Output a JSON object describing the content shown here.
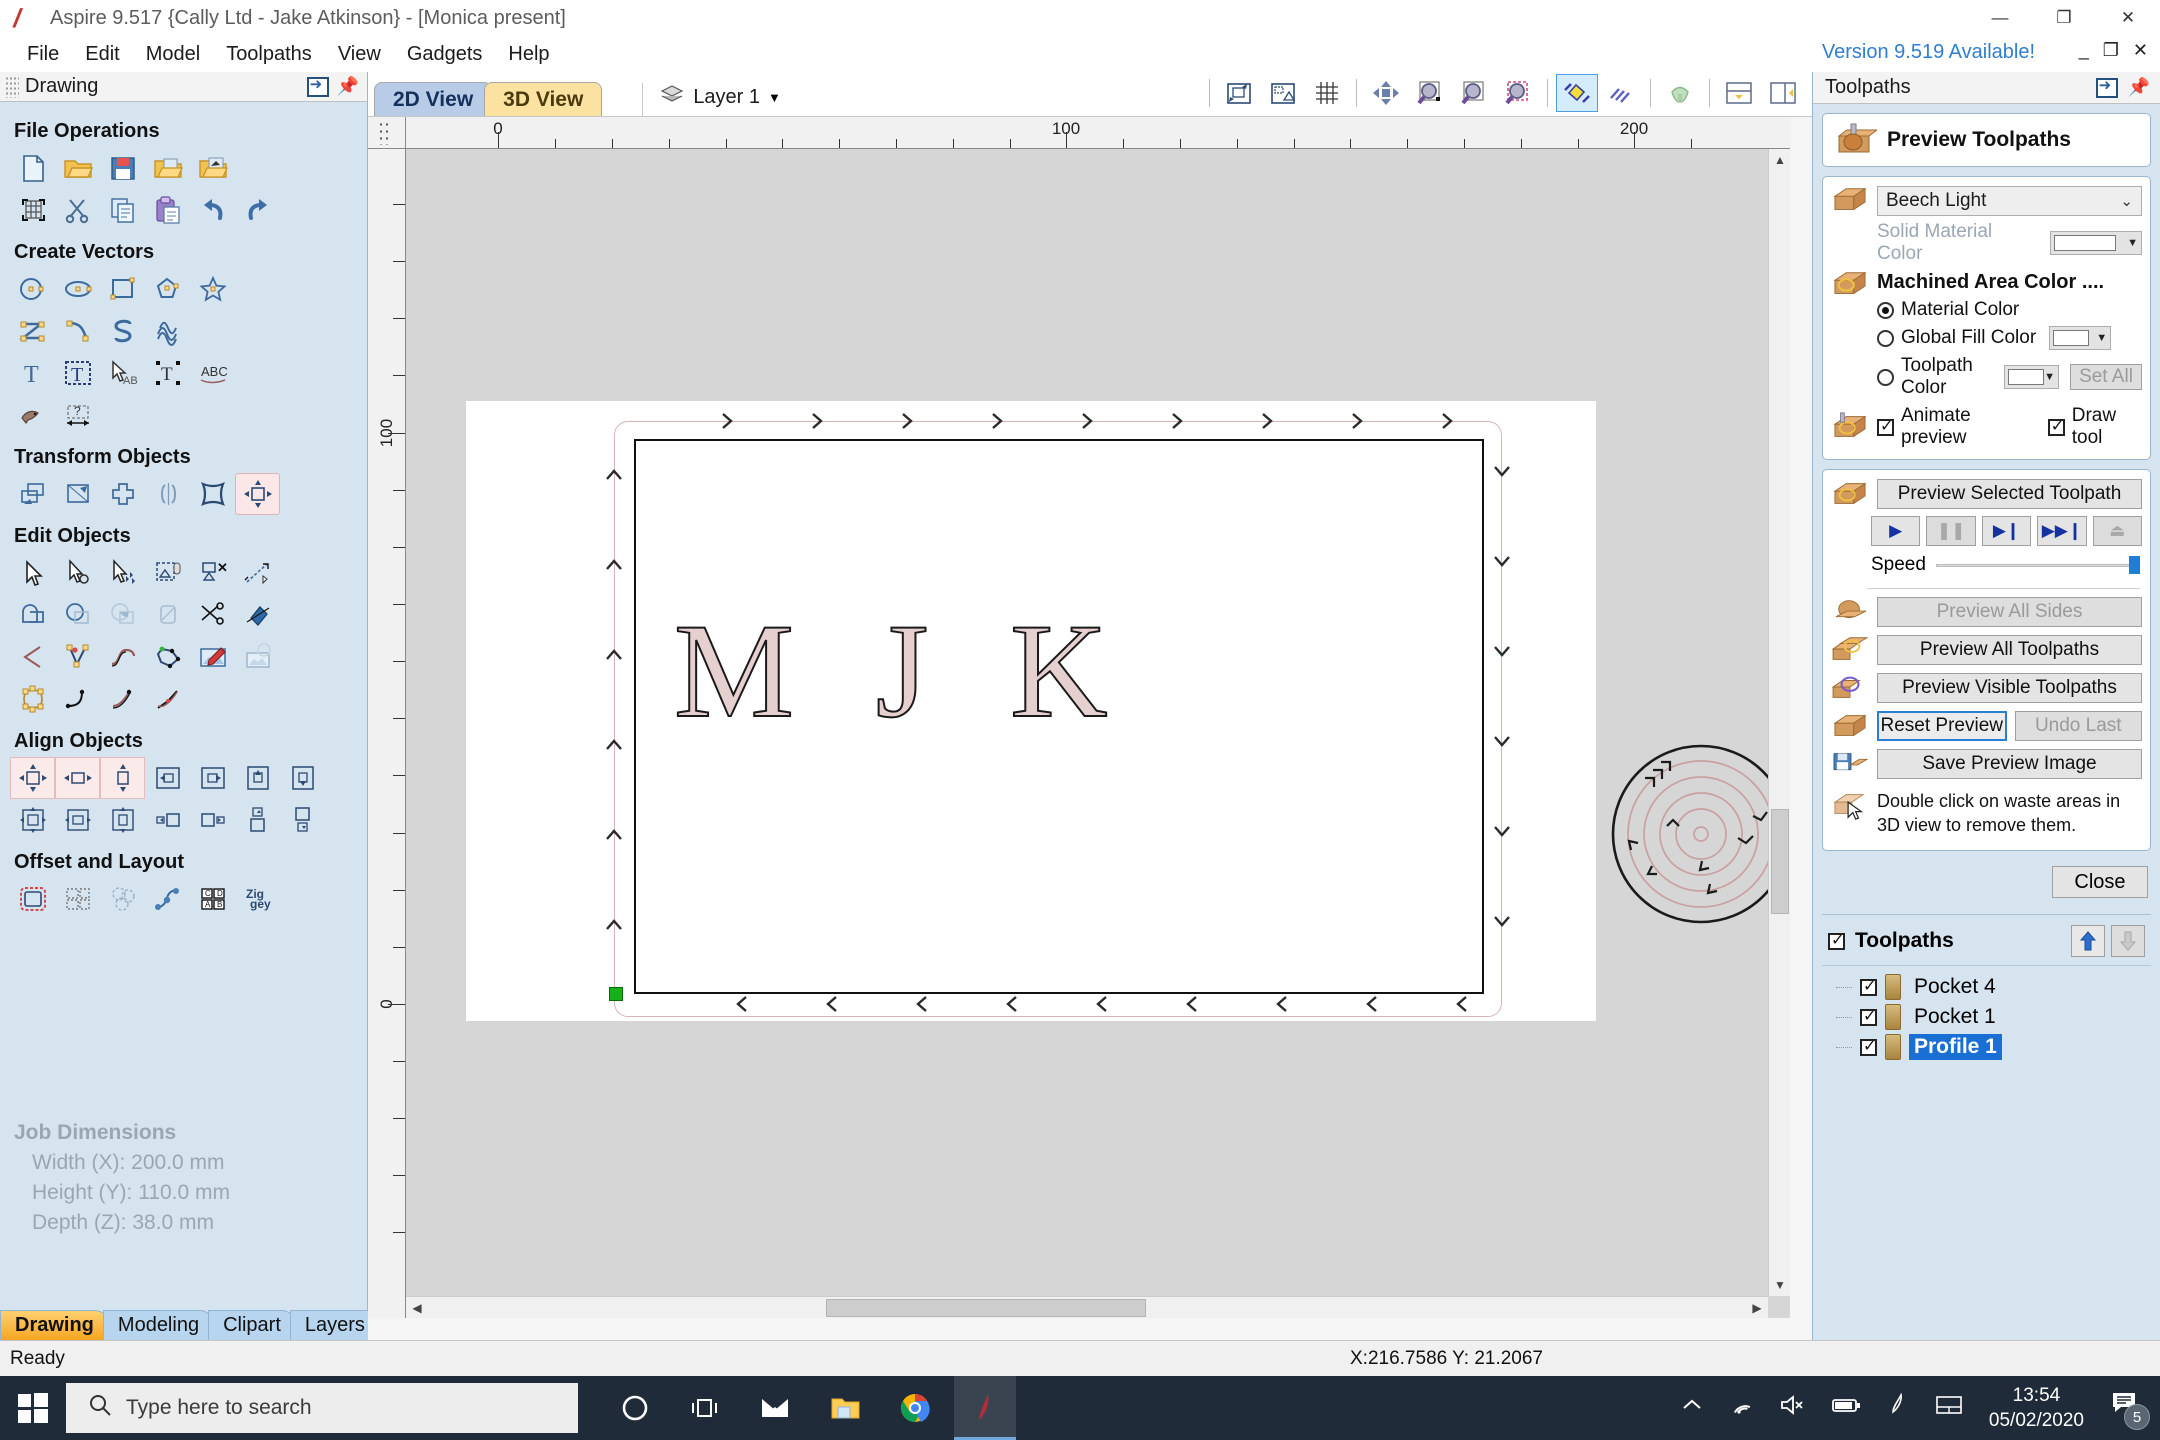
{
  "window": {
    "title": "Aspire 9.517 {Cally Ltd - Jake Atkinson} - [Monica present]",
    "version_note": "Version 9.519 Available!",
    "minimize": "—",
    "maximize": "❐",
    "close": "✕"
  },
  "menu": {
    "items": [
      "File",
      "Edit",
      "Model",
      "Toolpaths",
      "View",
      "Gadgets",
      "Help"
    ]
  },
  "left_dock": {
    "title": "Drawing",
    "sections": [
      {
        "title": "File Operations",
        "rows": [
          [
            "new-file-icon",
            "open-folder-icon",
            "save-icon",
            "open-recent-icon",
            "import-icon"
          ],
          [
            "job-setup-icon",
            "cut-icon",
            "copy-icon",
            "paste-icon",
            "undo-icon",
            "redo-icon"
          ]
        ]
      },
      {
        "title": "Create Vectors",
        "rows": [
          [
            "circle-icon",
            "ellipse-icon",
            "rectangle-icon",
            "polygon-icon",
            "star-icon"
          ],
          [
            "polyline-icon",
            "draw-curve-icon",
            "draw-s-curve-icon",
            "texture-icon"
          ],
          [
            "create-text-icon",
            "text-in-box-icon",
            "edit-text-icon",
            "text-selection-icon",
            "text-on-curve-icon"
          ],
          [
            "trace-bitmap-icon",
            "dimension-icon"
          ]
        ]
      },
      {
        "title": "Transform Objects",
        "rows": [
          [
            "move-icon",
            "scale-icon",
            "rotate-icon",
            "mirror-icon",
            "distort-icon",
            "set-size-icon"
          ]
        ]
      },
      {
        "title": "Edit Objects",
        "rows": [
          [
            "select-icon",
            "node-edit-icon",
            "transform-icon",
            "group-icon",
            "ungroup-icon",
            "measure-icon"
          ],
          [
            "weld-icon",
            "subtract-icon",
            "intersect-icon",
            "trim-icon",
            "scissors-icon",
            "fill-icon"
          ],
          [
            "join-open-icon",
            "insert-node-icon",
            "smooth-node-icon",
            "close-vector-icon",
            "bitmap-edit-icon",
            "fade-bitmap-icon"
          ],
          [
            "node-round-icon",
            "fillet-icon",
            "curve-fillet-icon",
            "chamfer-icon"
          ]
        ]
      },
      {
        "title": "Align Objects",
        "rows": [
          [
            "align-center-icon",
            "align-h-center-icon",
            "align-v-center-icon",
            "align-left-icon",
            "align-right-icon",
            "align-top-icon",
            "align-bottom-icon"
          ],
          [
            "align-center-obj-icon",
            "align-h-center-obj-icon",
            "align-v-center-obj-icon",
            "align-left-obj-icon",
            "align-right-obj-icon",
            "align-top-obj-icon",
            "align-bottom-obj-icon"
          ]
        ]
      },
      {
        "title": "Offset and Layout",
        "rows": [
          [
            "offset-icon",
            "array-copy-icon",
            "nest-icon",
            "copy-along-curve-icon",
            "block-copy-icon",
            "zigzag-icon"
          ]
        ]
      }
    ],
    "job_dimensions": {
      "heading": "Job Dimensions",
      "width": "Width  (X): 200.0 mm",
      "height": "Height (Y): 110.0 mm",
      "depth": "Depth  (Z): 38.0 mm"
    },
    "tabs": [
      {
        "label": "Drawing",
        "active": true
      },
      {
        "label": "Modeling",
        "active": false
      },
      {
        "label": "Clipart",
        "active": false
      },
      {
        "label": "Layers",
        "active": false
      }
    ]
  },
  "view": {
    "tabs": [
      {
        "label": "2D View",
        "active": true
      },
      {
        "label": "3D View",
        "active": false
      }
    ],
    "layer": "Layer 1",
    "layer_icon": "layers-icon",
    "toolbar_icons": [
      "zoom-to-selection-icon",
      "zoom-drawing-icon",
      "toggle-grid-icon",
      "pan-icon",
      "zoom-in-icon",
      "zoom-out-icon",
      "zoom-box-icon",
      "toggle-vectors-icon",
      "toggle-toolpaths-icon",
      "toggle-3d-model-icon",
      "split-horizontal-icon",
      "split-vertical-icon"
    ],
    "ruler_h_labels": [
      "0",
      "100",
      "200"
    ],
    "ruler_v_labels": [
      "100",
      "0"
    ],
    "design_text": "M J K",
    "spiral_icon": "pocket-spiral-toolpath"
  },
  "right_dock": {
    "title": "Toolpaths",
    "collapse_icon": "collapse-panel-icon",
    "pin_icon": "pin-icon",
    "form": {
      "heading": "Preview Toolpaths",
      "heading_icon": "preview-toolpaths-icon",
      "material_icon": "material-block-icon",
      "material": "Beech Light",
      "solid_material_color_label": "Solid Material Color",
      "machined_area_heading": "Machined Area Color ....",
      "machined_icon": "machined-area-icon",
      "options": [
        {
          "label": "Material Color",
          "selected": true,
          "has_color": false
        },
        {
          "label": "Global Fill Color",
          "selected": false,
          "has_color": true
        },
        {
          "label": "Toolpath Color",
          "selected": false,
          "has_color": true
        }
      ],
      "set_all": "Set All",
      "animate_preview": {
        "label": "Animate preview",
        "checked": true
      },
      "draw_tool": {
        "label": "Draw tool",
        "checked": true
      },
      "preview_selected": "Preview Selected Toolpath",
      "vcr": [
        {
          "name": "play-button",
          "glyph": "▶",
          "enabled": true
        },
        {
          "name": "pause-button",
          "glyph": "❚❚",
          "enabled": false
        },
        {
          "name": "step-button",
          "glyph": "▶❙",
          "enabled": true
        },
        {
          "name": "fast-forward-button",
          "glyph": "▶▶❙",
          "enabled": true
        },
        {
          "name": "stop-button",
          "glyph": "⏏",
          "enabled": false
        }
      ],
      "speed_label": "Speed",
      "speed_value": 100,
      "preview_all_sides": "Preview All Sides",
      "preview_all_toolpaths": "Preview All Toolpaths",
      "preview_visible_toolpaths": "Preview Visible Toolpaths",
      "reset_preview": "Reset Preview",
      "undo_last": "Undo Last",
      "save_preview_image": "Save Preview Image",
      "hint": "Double click on waste areas in 3D view to remove them.",
      "hint_icon": "waste-removal-icon",
      "close": "Close"
    },
    "toolpaths": {
      "title": "Toolpaths",
      "checked": true,
      "move_up_icon": "move-up-icon",
      "move_down_icon": "move-down-icon",
      "items": [
        {
          "name": "Pocket 4",
          "checked": true,
          "selected": false
        },
        {
          "name": "Pocket 1",
          "checked": true,
          "selected": false
        },
        {
          "name": "Profile 1",
          "checked": true,
          "selected": true
        }
      ]
    }
  },
  "status_bar": {
    "message": "Ready",
    "coords": "X:216.7586 Y: 21.2067"
  },
  "taskbar": {
    "start_icon": "windows-start-icon",
    "search_placeholder": "Type here to search",
    "search_icon": "search-icon",
    "pinned": [
      {
        "name": "cortana-icon",
        "active": false
      },
      {
        "name": "task-view-icon",
        "active": false
      },
      {
        "name": "mail-icon",
        "active": false
      },
      {
        "name": "file-explorer-icon",
        "active": false
      },
      {
        "name": "chrome-icon",
        "active": false
      },
      {
        "name": "aspire-icon",
        "active": true
      }
    ],
    "tray_icons": [
      "show-hidden-icons",
      "wifi-icon",
      "volume-muted-icon",
      "battery-icon",
      "pen-icon",
      "touchpad-icon"
    ],
    "time": "13:54",
    "date": "05/02/2020",
    "notification_count": "5"
  },
  "colors": {
    "accent_blue": "#1a6fd4",
    "dock_bg": "#d6e4f0",
    "toolpath_pink": "#d8b4b4",
    "active_tab_orange": "#f5a623",
    "taskbar": "#1f2b38"
  }
}
